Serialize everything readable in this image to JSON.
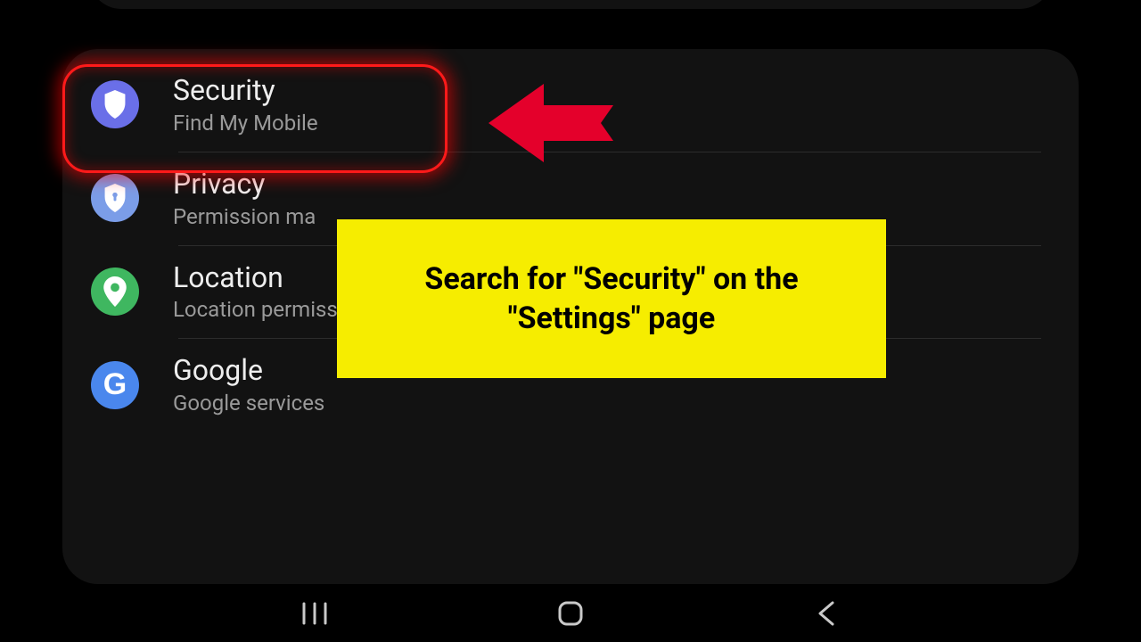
{
  "settings": {
    "items": [
      {
        "title": "Security",
        "subtitle": "Find My Mobile",
        "icon": "shield-icon",
        "bg": "#6a6fe8"
      },
      {
        "title": "Privacy",
        "subtitle": "Permission ma",
        "icon": "shield-lock-icon",
        "bg": "#7b9de8"
      },
      {
        "title": "Location",
        "subtitle": "Location permissions  •  Location requests",
        "icon": "pin-icon",
        "bg": "#3fb760"
      },
      {
        "title": "Google",
        "subtitle": "Google services",
        "icon": "google-g-icon",
        "bg": "#4a87ed"
      }
    ]
  },
  "annotation": {
    "callout_text": "Search for \"Security\" on the\n\"Settings\" page"
  },
  "colors": {
    "highlight": "#ff1a1a",
    "callout_bg": "#f6ed00"
  }
}
